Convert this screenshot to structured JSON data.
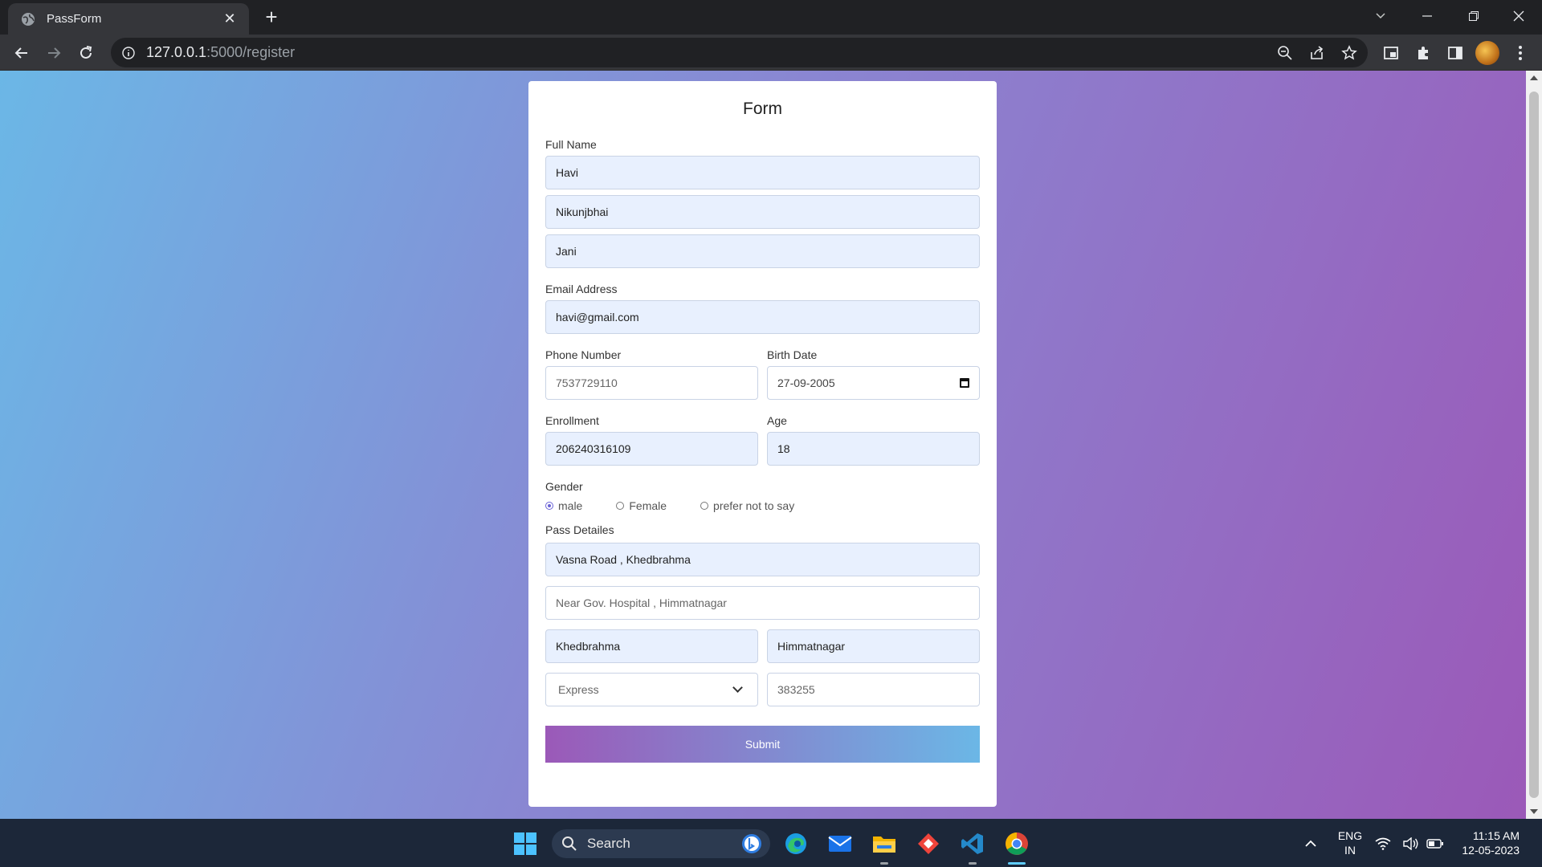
{
  "browser": {
    "tab_title": "PassForm",
    "url_host": "127.0.0.1",
    "url_path": ":5000/register"
  },
  "form": {
    "title": "Form",
    "full_name_label": "Full Name",
    "first_name": "Havi",
    "middle_name": "Nikunjbhai",
    "last_name": "Jani",
    "email_label": "Email Address",
    "email": "havi@gmail.com",
    "phone_label": "Phone Number",
    "phone_placeholder": "7537729110",
    "birth_label": "Birth Date",
    "birth_date": "27-09-2005",
    "enrollment_label": "Enrollment",
    "enrollment": "206240316109",
    "age_label": "Age",
    "age": "18",
    "gender_label": "Gender",
    "gender_options": [
      "male",
      "Female",
      "prefer not to say"
    ],
    "gender_selected": "male",
    "pass_label": "Pass Detailes",
    "address_line1": "Vasna Road , Khedbrahma",
    "address_line2_placeholder": "Near Gov. Hospital , Himmatnagar",
    "from_city": "Khedbrahma",
    "to_city": "Himmatnagar",
    "pass_type_selected": "Express",
    "pincode_placeholder": "383255",
    "submit_label": "Submit"
  },
  "taskbar": {
    "search_label": "Search",
    "lang_line1": "ENG",
    "lang_line2": "IN",
    "time": "11:15 AM",
    "date": "12-05-2023"
  }
}
